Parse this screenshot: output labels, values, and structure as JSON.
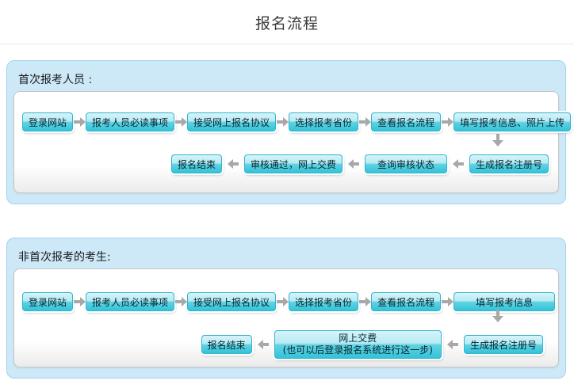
{
  "page": {
    "title": "报名流程"
  },
  "colors": {
    "panel_background": "#cde9f8",
    "panel_border": "#a2d4ec",
    "step_gradient_top": "#d7f3f9",
    "step_gradient_bottom": "#30c1d7",
    "step_border": "#2fb6cc",
    "arrow": "#a8a8a8"
  },
  "first_time": {
    "label": "首次报考人员 :",
    "row1": [
      "登录网站",
      "报考人员必读事项",
      "接受网上报名协议",
      "选择报考省份",
      "查看报名流程",
      "填写报考信息、照片上传"
    ],
    "row2": {
      "finish": "报名结束",
      "payment": "审核通过，网上交费",
      "status": "查询审核状态",
      "register": "生成报名注册号"
    }
  },
  "repeat_exam": {
    "label": "非首次报考的考生:",
    "row1": [
      "登录网站",
      "报考人员必读事项",
      "接受网上报名协议",
      "选择报考省份",
      "查看报名流程",
      "填写报考信息"
    ],
    "row2": {
      "finish": "报名结束",
      "payment_line1": "网上交费",
      "payment_line2": "(也可以后登录报名系统进行这一步)",
      "register": "生成报名注册号"
    }
  }
}
